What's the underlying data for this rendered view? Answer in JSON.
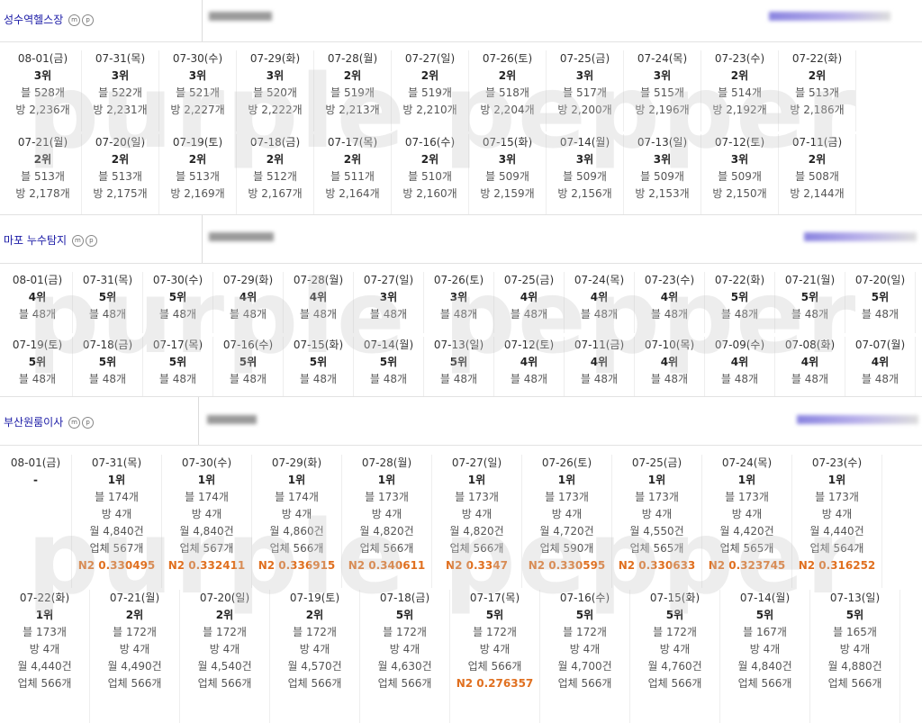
{
  "sections": [
    {
      "keyword": "성수역헬스장",
      "icons": [
        "m-circle-icon",
        "p-circle-icon"
      ],
      "rows": [
        [
          {
            "date": "08-01(금)",
            "rank": "3위",
            "lines": [
              "블 528개",
              "방 2,236개"
            ]
          },
          {
            "date": "07-31(목)",
            "rank": "3위",
            "lines": [
              "블 522개",
              "방 2,231개"
            ]
          },
          {
            "date": "07-30(수)",
            "rank": "3위",
            "lines": [
              "블 521개",
              "방 2,227개"
            ]
          },
          {
            "date": "07-29(화)",
            "rank": "3위",
            "lines": [
              "블 520개",
              "방 2,222개"
            ]
          },
          {
            "date": "07-28(월)",
            "rank": "2위",
            "lines": [
              "블 519개",
              "방 2,213개"
            ]
          },
          {
            "date": "07-27(일)",
            "rank": "2위",
            "lines": [
              "블 519개",
              "방 2,210개"
            ]
          },
          {
            "date": "07-26(토)",
            "rank": "2위",
            "lines": [
              "블 518개",
              "방 2,204개"
            ]
          },
          {
            "date": "07-25(금)",
            "rank": "3위",
            "lines": [
              "블 517개",
              "방 2,200개"
            ]
          },
          {
            "date": "07-24(목)",
            "rank": "3위",
            "lines": [
              "블 515개",
              "방 2,196개"
            ]
          },
          {
            "date": "07-23(수)",
            "rank": "2위",
            "lines": [
              "블 514개",
              "방 2,192개"
            ]
          },
          {
            "date": "07-22(화)",
            "rank": "2위",
            "lines": [
              "블 513개",
              "방 2,186개"
            ]
          }
        ],
        [
          {
            "date": "07-21(월)",
            "rank": "2위",
            "lines": [
              "블 513개",
              "방 2,178개"
            ]
          },
          {
            "date": "07-20(일)",
            "rank": "2위",
            "lines": [
              "블 513개",
              "방 2,175개"
            ]
          },
          {
            "date": "07-19(토)",
            "rank": "2위",
            "lines": [
              "블 513개",
              "방 2,169개"
            ]
          },
          {
            "date": "07-18(금)",
            "rank": "2위",
            "lines": [
              "블 512개",
              "방 2,167개"
            ]
          },
          {
            "date": "07-17(목)",
            "rank": "2위",
            "lines": [
              "블 511개",
              "방 2,164개"
            ]
          },
          {
            "date": "07-16(수)",
            "rank": "2위",
            "lines": [
              "블 510개",
              "방 2,160개"
            ]
          },
          {
            "date": "07-15(화)",
            "rank": "3위",
            "lines": [
              "블 509개",
              "방 2,159개"
            ]
          },
          {
            "date": "07-14(월)",
            "rank": "3위",
            "lines": [
              "블 509개",
              "방 2,156개"
            ]
          },
          {
            "date": "07-13(일)",
            "rank": "3위",
            "lines": [
              "블 509개",
              "방 2,153개"
            ]
          },
          {
            "date": "07-12(토)",
            "rank": "3위",
            "lines": [
              "블 509개",
              "방 2,150개"
            ]
          },
          {
            "date": "07-11(금)",
            "rank": "2위",
            "lines": [
              "블 508개",
              "방 2,144개"
            ]
          }
        ]
      ]
    },
    {
      "keyword": "마포 누수탐지",
      "icons": [
        "m-circle-icon",
        "p-circle-icon"
      ],
      "rows": [
        [
          {
            "date": "08-01(금)",
            "rank": "4위",
            "lines": [
              "블 48개"
            ]
          },
          {
            "date": "07-31(목)",
            "rank": "5위",
            "lines": [
              "블 48개"
            ]
          },
          {
            "date": "07-30(수)",
            "rank": "5위",
            "lines": [
              "블 48개"
            ]
          },
          {
            "date": "07-29(화)",
            "rank": "4위",
            "lines": [
              "블 48개"
            ]
          },
          {
            "date": "07-28(월)",
            "rank": "4위",
            "lines": [
              "블 48개"
            ]
          },
          {
            "date": "07-27(일)",
            "rank": "3위",
            "lines": [
              "블 48개"
            ]
          },
          {
            "date": "07-26(토)",
            "rank": "3위",
            "lines": [
              "블 48개"
            ]
          },
          {
            "date": "07-25(금)",
            "rank": "4위",
            "lines": [
              "블 48개"
            ]
          },
          {
            "date": "07-24(목)",
            "rank": "4위",
            "lines": [
              "블 48개"
            ]
          },
          {
            "date": "07-23(수)",
            "rank": "4위",
            "lines": [
              "블 48개"
            ]
          },
          {
            "date": "07-22(화)",
            "rank": "5위",
            "lines": [
              "블 48개"
            ]
          },
          {
            "date": "07-21(월)",
            "rank": "5위",
            "lines": [
              "블 48개"
            ]
          },
          {
            "date": "07-20(일)",
            "rank": "5위",
            "lines": [
              "블 48개"
            ]
          }
        ],
        [
          {
            "date": "07-19(토)",
            "rank": "5위",
            "lines": [
              "블 48개"
            ]
          },
          {
            "date": "07-18(금)",
            "rank": "5위",
            "lines": [
              "블 48개"
            ]
          },
          {
            "date": "07-17(목)",
            "rank": "5위",
            "lines": [
              "블 48개"
            ]
          },
          {
            "date": "07-16(수)",
            "rank": "5위",
            "lines": [
              "블 48개"
            ]
          },
          {
            "date": "07-15(화)",
            "rank": "5위",
            "lines": [
              "블 48개"
            ]
          },
          {
            "date": "07-14(월)",
            "rank": "5위",
            "lines": [
              "블 48개"
            ]
          },
          {
            "date": "07-13(일)",
            "rank": "5위",
            "lines": [
              "블 48개"
            ]
          },
          {
            "date": "07-12(토)",
            "rank": "4위",
            "lines": [
              "블 48개"
            ]
          },
          {
            "date": "07-11(금)",
            "rank": "4위",
            "lines": [
              "블 48개"
            ]
          },
          {
            "date": "07-10(목)",
            "rank": "4위",
            "lines": [
              "블 48개"
            ]
          },
          {
            "date": "07-09(수)",
            "rank": "4위",
            "lines": [
              "블 48개"
            ]
          },
          {
            "date": "07-08(화)",
            "rank": "4위",
            "lines": [
              "블 48개"
            ]
          },
          {
            "date": "07-07(월)",
            "rank": "4위",
            "lines": [
              "블 48개"
            ]
          }
        ]
      ]
    },
    {
      "keyword": "부산원룸이사",
      "icons": [
        "m-circle-icon",
        "p-circle-icon"
      ],
      "rows": [
        [
          {
            "date": "08-01(금)",
            "rank": "-",
            "lines": []
          },
          {
            "date": "07-31(목)",
            "rank": "1위",
            "lines": [
              "블 174개",
              "방 4개",
              "월 4,840건",
              "업체 567개"
            ],
            "n2": "N2 0.330495"
          },
          {
            "date": "07-30(수)",
            "rank": "1위",
            "lines": [
              "블 174개",
              "방 4개",
              "월 4,840건",
              "업체 567개"
            ],
            "n2": "N2 0.332411"
          },
          {
            "date": "07-29(화)",
            "rank": "1위",
            "lines": [
              "블 174개",
              "방 4개",
              "월 4,860건",
              "업체 566개"
            ],
            "n2": "N2 0.336915"
          },
          {
            "date": "07-28(월)",
            "rank": "1위",
            "lines": [
              "블 173개",
              "방 4개",
              "월 4,820건",
              "업체 566개"
            ],
            "n2": "N2 0.340611"
          },
          {
            "date": "07-27(일)",
            "rank": "1위",
            "lines": [
              "블 173개",
              "방 4개",
              "월 4,820건",
              "업체 566개"
            ],
            "n2": "N2 0.3347"
          },
          {
            "date": "07-26(토)",
            "rank": "1위",
            "lines": [
              "블 173개",
              "방 4개",
              "월 4,720건",
              "업체 590개"
            ],
            "n2": "N2 0.330595"
          },
          {
            "date": "07-25(금)",
            "rank": "1위",
            "lines": [
              "블 173개",
              "방 4개",
              "월 4,550건",
              "업체 565개"
            ],
            "n2": "N2 0.330633"
          },
          {
            "date": "07-24(목)",
            "rank": "1위",
            "lines": [
              "블 173개",
              "방 4개",
              "월 4,420건",
              "업체 565개"
            ],
            "n2": "N2 0.323745"
          },
          {
            "date": "07-23(수)",
            "rank": "1위",
            "lines": [
              "블 173개",
              "방 4개",
              "월 4,440건",
              "업체 564개"
            ],
            "n2": "N2 0.316252"
          }
        ],
        [
          {
            "date": "07-22(화)",
            "rank": "1위",
            "lines": [
              "블 173개",
              "방 4개",
              "월 4,440건",
              "업체 566개"
            ]
          },
          {
            "date": "07-21(월)",
            "rank": "2위",
            "lines": [
              "블 172개",
              "방 4개",
              "월 4,490건",
              "업체 566개"
            ]
          },
          {
            "date": "07-20(일)",
            "rank": "2위",
            "lines": [
              "블 172개",
              "방 4개",
              "월 4,540건",
              "업체 566개"
            ]
          },
          {
            "date": "07-19(토)",
            "rank": "2위",
            "lines": [
              "블 172개",
              "방 4개",
              "월 4,570건",
              "업체 566개"
            ]
          },
          {
            "date": "07-18(금)",
            "rank": "5위",
            "lines": [
              "블 172개",
              "방 4개",
              "월 4,630건",
              "업체 566개"
            ]
          },
          {
            "date": "07-17(목)",
            "rank": "5위",
            "lines": [
              "블 172개",
              "방 4개",
              "업체 566개"
            ],
            "n2": "N2 0.276357"
          },
          {
            "date": "07-16(수)",
            "rank": "5위",
            "lines": [
              "블 172개",
              "방 4개",
              "월 4,700건",
              "업체 566개"
            ]
          },
          {
            "date": "07-15(화)",
            "rank": "5위",
            "lines": [
              "블 172개",
              "방 4개",
              "월 4,760건",
              "업체 566개"
            ]
          },
          {
            "date": "07-14(월)",
            "rank": "5위",
            "lines": [
              "블 167개",
              "방 4개",
              "월 4,840건",
              "업체 566개"
            ]
          },
          {
            "date": "07-13(일)",
            "rank": "5위",
            "lines": [
              "블 165개",
              "방 4개",
              "월 4,880건",
              "업체 566개"
            ]
          }
        ]
      ]
    }
  ],
  "watermark": "purple pepper",
  "colors": {
    "keyword": "#1a1aa6",
    "n2": "#e07020",
    "redacted": "#b8b0ea"
  }
}
